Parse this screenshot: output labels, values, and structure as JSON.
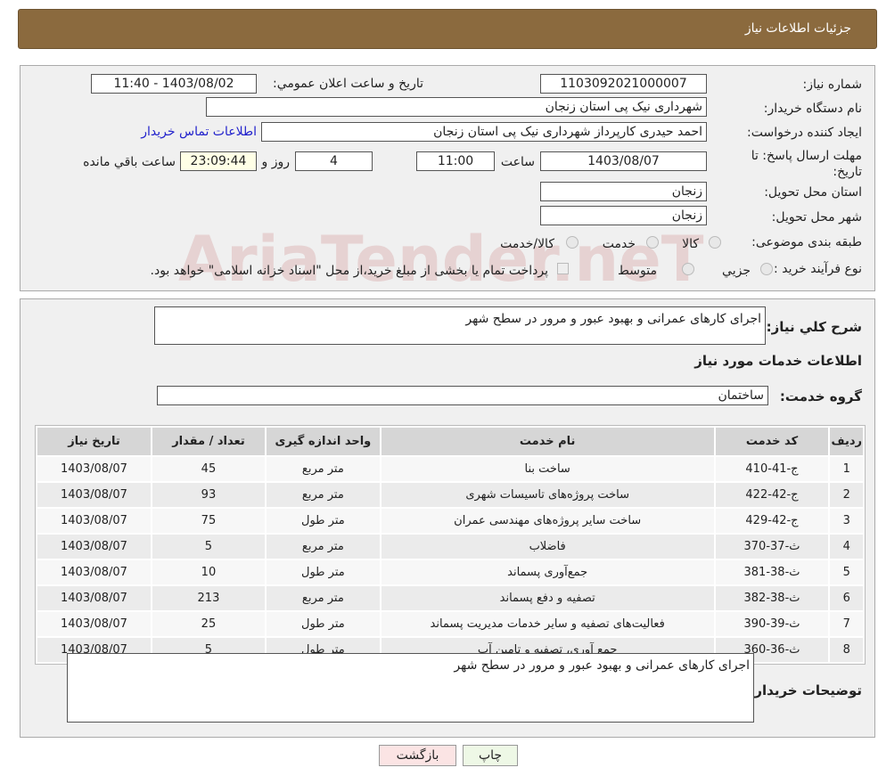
{
  "header": {
    "title": "جزئيات اطلاعات نياز"
  },
  "form": {
    "need_number_label": "شماره نیاز:",
    "need_number": "1103092021000007",
    "announce_label": "تاريخ و ساعت اعلان عمومي:",
    "announce_value": "1403/08/02 - 11:40",
    "buyer_label": "نام دستگاه خريدار:",
    "buyer": "شهرداری نیک پی استان زنجان",
    "creator_label": "ايجاد کننده درخواست:",
    "creator": "احمد حیدری کارپرداز شهرداری نیک پی استان زنجان",
    "contact_link": "اطلاعات تماس خريدار",
    "deadline_label": "مهلت ارسال پاسخ: تا تاریخ:",
    "deadline_date": "1403/08/07",
    "time_label": "ساعت",
    "deadline_time": "11:00",
    "days": "4",
    "days_label": "روز و",
    "remaining": "23:09:44",
    "remaining_label": "ساعت باقي مانده",
    "province_label": "استان محل تحویل:",
    "province": "زنجان",
    "city_label": "شهر محل تحویل:",
    "city": "زنجان",
    "category_label": "طبقه بندی موضوعی:",
    "category_options": [
      "کالا",
      "خدمت",
      "کالا/خدمت"
    ],
    "process_label": "نوع فرآیند خرید :",
    "process_options": [
      "جزيي",
      "متوسط"
    ],
    "payment_note": "پرداخت تمام يا بخشی از مبلغ خريد،از محل \"اسناد خزانه اسلامی\" خواهد بود."
  },
  "watermark": "AriaTender.neT",
  "details": {
    "summary_label": "شرح کلي نياز:",
    "summary": "اجرای کارهای عمرانی و بهبود عبور و مرور در سطح شهر",
    "services_title": "اطلاعات خدمات مورد نياز",
    "group_label": "گروه خدمت:",
    "group": "ساختمان",
    "columns": [
      "رديف",
      "کد خدمت",
      "نام خدمت",
      "واحد اندازه گيری",
      "تعداد / مقدار",
      "تاريخ نياز"
    ],
    "rows": [
      [
        "1",
        "ج-41-410",
        "ساخت بنا",
        "متر مربع",
        "45",
        "1403/08/07"
      ],
      [
        "2",
        "ج-42-422",
        "ساخت پروژه‌های تاسیسات شهری",
        "متر مربع",
        "93",
        "1403/08/07"
      ],
      [
        "3",
        "ج-42-429",
        "ساخت سایر پروژه‌های مهندسی عمران",
        "متر طول",
        "75",
        "1403/08/07"
      ],
      [
        "4",
        "ث-37-370",
        "فاضلاب",
        "متر مربع",
        "5",
        "1403/08/07"
      ],
      [
        "5",
        "ث-38-381",
        "جمع‌آوری پسماند",
        "متر طول",
        "10",
        "1403/08/07"
      ],
      [
        "6",
        "ث-38-382",
        "تصفیه و دفع پسماند",
        "متر مربع",
        "213",
        "1403/08/07"
      ],
      [
        "7",
        "ث-39-390",
        "فعالیت‌های تصفیه و سایر خدمات مدیریت پسماند",
        "متر طول",
        "25",
        "1403/08/07"
      ],
      [
        "8",
        "ث-36-360",
        "جمع آوری، تصفیه و تامین آب",
        "متر طول",
        "5",
        "1403/08/07"
      ]
    ],
    "buyer_notes_label": "توضيحات خريدار:",
    "buyer_notes": "اجرای کارهای عمرانی و بهبود عبور و مرور در سطح شهر"
  },
  "buttons": {
    "print": "چاپ",
    "back": "بازگشت"
  }
}
